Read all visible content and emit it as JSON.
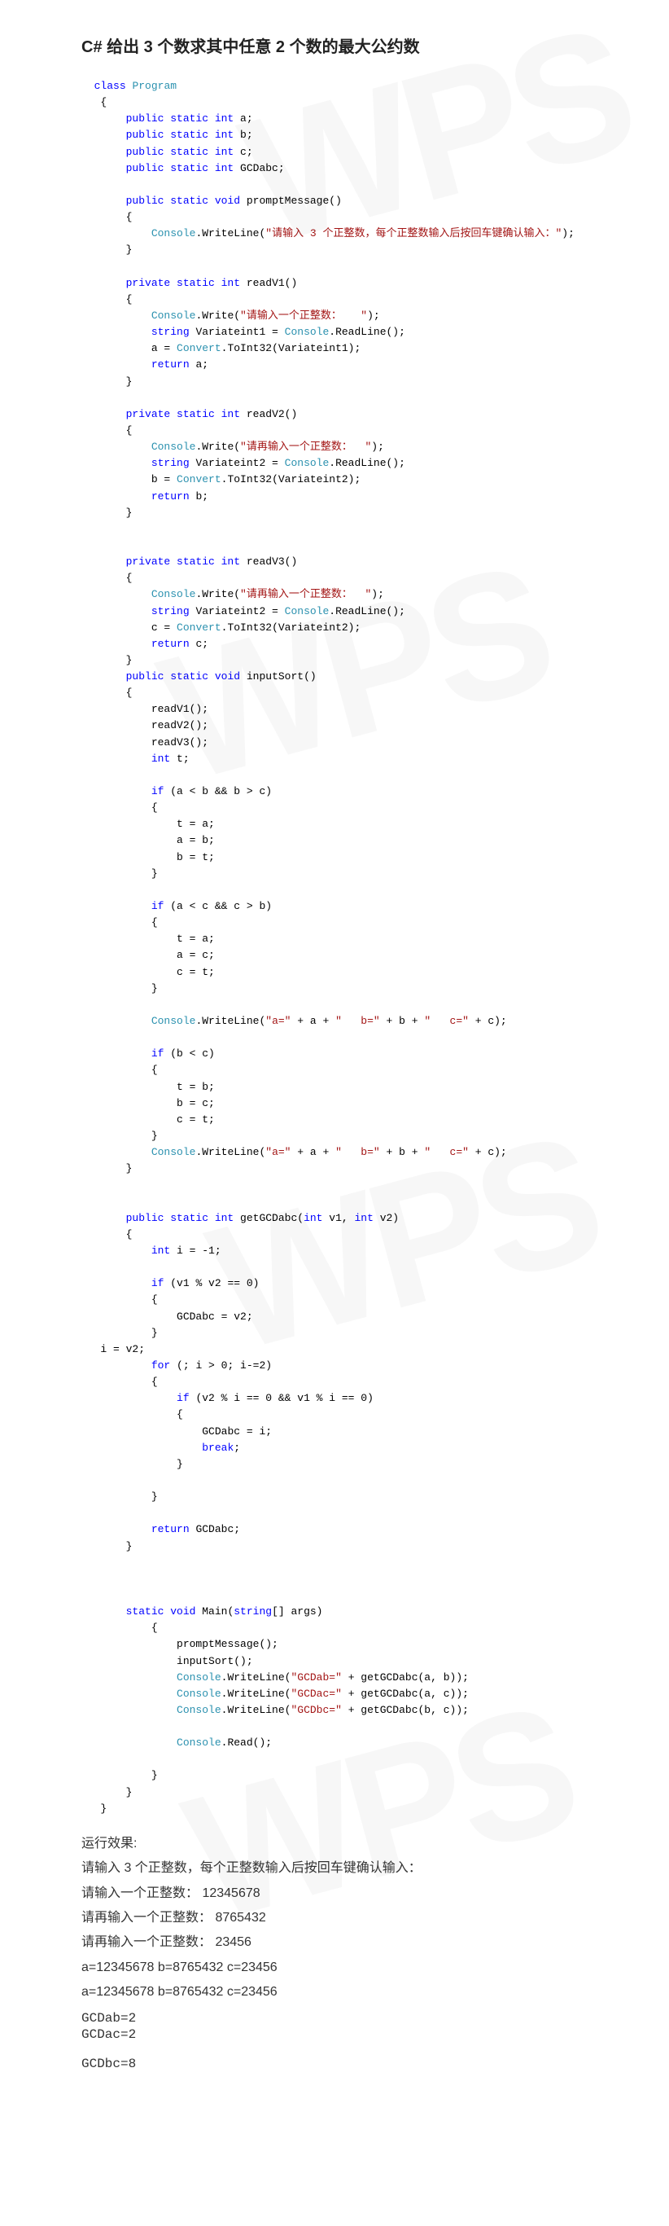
{
  "title": "C#  给出 3 个数求其中任意 2 个数的最大公约数",
  "code": {
    "watermarks": [
      "WPS",
      "WPS",
      "WPS",
      "WPS"
    ],
    "classLine_kw1": "class",
    "classLine_cls": "Program",
    "field_kw": "public static int",
    "field_a": "a;",
    "field_b": "b;",
    "field_c": "c;",
    "field_gcd": "GCDabc;",
    "prompt_sig_kw": "public static void",
    "prompt_name": "promptMessage()",
    "prompt_cls": "Console",
    "prompt_call": ".WriteLine(",
    "prompt_str": "\"请输入 3 个正整数，每个正整数输入后按回车键确认输入：\"",
    "prompt_close": ");",
    "readv1_sig_kw": "private static int",
    "readv1_name": "readV1()",
    "readv1_write_cls": "Console",
    "readv1_write_call": ".Write(",
    "readv1_write_str": "\"请输入一个正整数：   \"",
    "readv1_write_close": ");",
    "readv1_line2_kw": "string",
    "readv1_line2_rest": " Variateint1 = ",
    "readv1_line2_cls": "Console",
    "readv1_line2_tail": ".ReadLine();",
    "readv1_line3_pre": "a = ",
    "readv1_line3_cls": "Convert",
    "readv1_line3_tail": ".ToInt32(Variateint1);",
    "readv1_ret_kw": "return",
    "readv1_ret_tail": " a;",
    "readv2_sig_kw": "private static int",
    "readv2_name": "readV2()",
    "readv2_write_str": "\"请再输入一个正整数：  \"",
    "readv2_line2_rest": " Variateint2 = ",
    "readv2_line3_pre": "b = ",
    "readv2_line3_tail": ".ToInt32(Variateint2);",
    "readv2_ret_tail": " b;",
    "readv3_sig_kw": "private static int",
    "readv3_name": "readV3()",
    "readv3_write_str": "\"请再输入一个正整数：  \"",
    "readv3_line3_pre": "c = ",
    "readv3_line3_tail": ".ToInt32(Variateint2);",
    "readv3_ret_tail": " c;",
    "inputSort_sig_kw": "public static void",
    "inputSort_name": "inputSort()",
    "is_l1": "readV1();",
    "is_l2": "readV2();",
    "is_l3": "readV3();",
    "is_l4_kw": "int",
    "is_l4_tail": " t;",
    "is_if1_kw": "if",
    "is_if1_cond": " (a < b && b > c)",
    "is_if1_b1": "t = a;",
    "is_if1_b2": "a = b;",
    "is_if1_b3": "b = t;",
    "is_if2_cond": " (a < c && c > b)",
    "is_if2_b1": "t = a;",
    "is_if2_b2": "a = c;",
    "is_if2_b3": "c = t;",
    "is_wl_cls": "Console",
    "is_wl_call": ".WriteLine(",
    "is_wl_str1": "\"a=\"",
    "is_wl_mid1": " + a + ",
    "is_wl_str2": "\"   b=\"",
    "is_wl_mid2": " + b + ",
    "is_wl_str3": "\"   c=\"",
    "is_wl_mid3": " + c);",
    "is_if3_cond": " (b < c)",
    "is_if3_b1": "t = b;",
    "is_if3_b2": "b = c;",
    "is_if3_b3": "c = t;",
    "gcd_sig_kw": "public static int",
    "gcd_name": "getGCDabc(",
    "gcd_param_kw1": "int",
    "gcd_param1": " v1, ",
    "gcd_param_kw2": "int",
    "gcd_param2": " v2)",
    "gcd_l1_kw": "int",
    "gcd_l1_tail": " i = -1;",
    "gcd_if1_kw": "if",
    "gcd_if1_cond": " (v1 % v2 == 0)",
    "gcd_if1_body": "GCDabc = v2;",
    "gcd_assign_i": "i = v2;",
    "gcd_for_kw": "for",
    "gcd_for_cond": " (; i > 0; i-=2)",
    "gcd_if2_cond": " (v2 % i == 0 && v1 % i == 0)",
    "gcd_if2_b1": "GCDabc = i;",
    "gcd_if2_b2_kw": "break",
    "gcd_if2_b2_tail": ";",
    "gcd_ret_kw": "return",
    "gcd_ret_tail": " GCDabc;",
    "main_sig_kw": "static void",
    "main_name": " Main(",
    "main_param_kw": "string",
    "main_param_tail": "[] args)",
    "main_l1": "promptMessage();",
    "main_l2": "inputSort();",
    "main_wl_str1": "\"GCDab=\"",
    "main_wl_t1": " + getGCDabc(a, b));",
    "main_wl_str2": "\"GCDac=\"",
    "main_wl_t2": " + getGCDabc(a, c));",
    "main_wl_str3": "\"GCDbc=\"",
    "main_wl_t3": " + getGCDabc(b, c));",
    "main_read": ".Read();"
  },
  "output": {
    "label": "运行效果:",
    "l1": "请输入 3 个正整数，每个正整数输入后按回车键确认输入：",
    "l2": "请输入一个正整数：     12345678",
    "l3": "请再输入一个正整数：  8765432",
    "l4": "请再输入一个正整数：   23456",
    "l5": "a=12345678     b=8765432     c=23456",
    "l6": "a=12345678     b=8765432     c=23456",
    "l7": "GCDab=2",
    "l8": "GCDac=2",
    "l9": "GCDbc=8"
  }
}
